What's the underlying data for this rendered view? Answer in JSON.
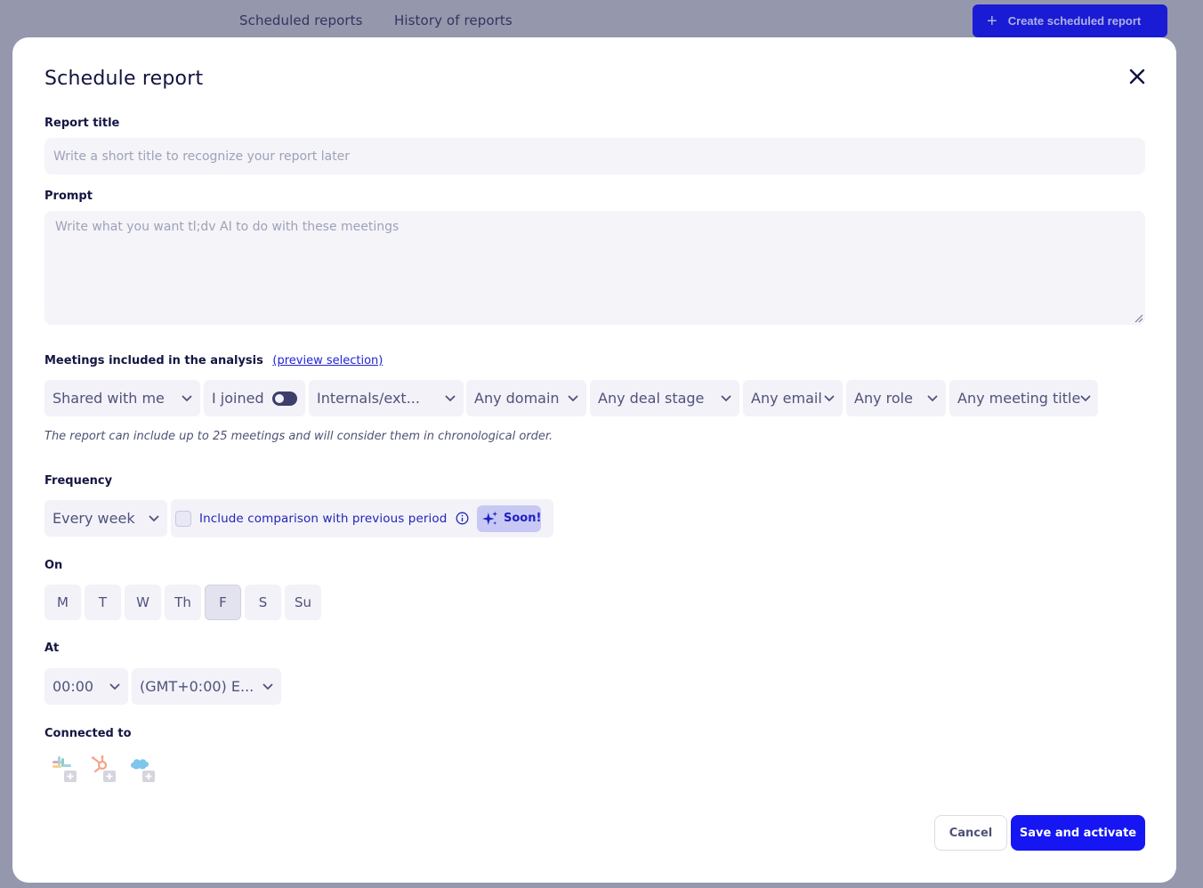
{
  "background": {
    "tabs": [
      "Scheduled reports",
      "History of reports"
    ],
    "create_button": "Create scheduled report"
  },
  "modal": {
    "title": "Schedule report",
    "report_title": {
      "label": "Report title",
      "placeholder": "Write a short title to recognize your report later"
    },
    "prompt": {
      "label": "Prompt",
      "placeholder": "Write what you want tl;dv AI to do with these meetings"
    },
    "meetings": {
      "label": "Meetings included in the analysis",
      "preview_link": "(preview selection)",
      "filters": {
        "shared": "Shared with me",
        "joined": "I joined",
        "internals": "Internals/ext...",
        "domain": "Any domain",
        "deal_stage": "Any deal stage",
        "email": "Any email",
        "role": "Any role",
        "meeting_title": "Any meeting title"
      },
      "note": "The report can include up to 25 meetings and will consider them in chronological order."
    },
    "frequency": {
      "label": "Frequency",
      "value": "Every week",
      "comparison": "Include comparison with previous period",
      "soon_badge": "Soon!"
    },
    "on": {
      "label": "On",
      "days": [
        "M",
        "T",
        "W",
        "Th",
        "F",
        "S",
        "Su"
      ],
      "selected": "F"
    },
    "at": {
      "label": "At",
      "time": "00:00",
      "timezone": "(GMT+0:00) E..."
    },
    "connected": {
      "label": "Connected to",
      "integrations": [
        "slack-icon",
        "hubspot-icon",
        "salesforce-icon"
      ]
    },
    "actions": {
      "cancel": "Cancel",
      "save": "Save and activate"
    }
  },
  "colors": {
    "overlay": "#9597ad",
    "primary": "#1516f2",
    "field_bg": "#f4f4f9"
  }
}
